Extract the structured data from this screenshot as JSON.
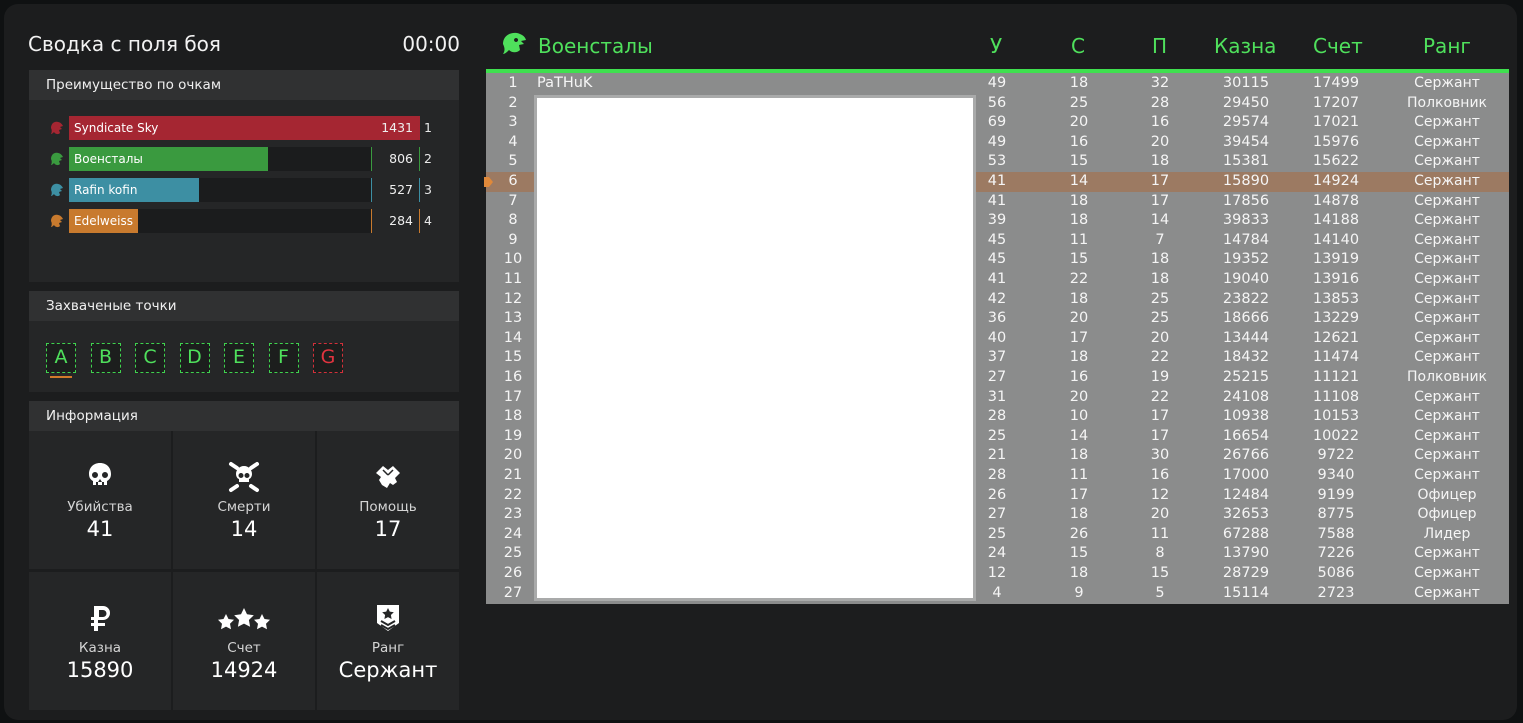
{
  "summary": {
    "title": "Сводка с поля боя",
    "timer": "00:00"
  },
  "points_advantage": {
    "title": "Преимущество по очкам",
    "teams": [
      {
        "name": "Syndicate Sky",
        "score": "1431",
        "place": "1",
        "color": "#a52632",
        "fraction": 1.0,
        "icon": "eagle-icon"
      },
      {
        "name": "Военсталы",
        "score": "806",
        "place": "2",
        "color": "#3a9a3f",
        "fraction": 0.66,
        "icon": "eagle-icon"
      },
      {
        "name": "Rafin kofin",
        "score": "527",
        "place": "3",
        "color": "#3d8fa3",
        "fraction": 0.43,
        "icon": "wolf-icon"
      },
      {
        "name": "Edelweiss",
        "score": "284",
        "place": "4",
        "color": "#c87a2e",
        "fraction": 0.23,
        "icon": "eagle-icon"
      }
    ]
  },
  "captured_points": {
    "title": "Захваченые точки",
    "points": [
      "A",
      "B",
      "C",
      "D",
      "E",
      "F",
      "G"
    ]
  },
  "info": {
    "title": "Информация",
    "kills_label": "Убийства",
    "kills": "41",
    "deaths_label": "Смерти",
    "deaths": "14",
    "assists_label": "Помощь",
    "assists": "17",
    "treasury_label": "Казна",
    "treasury": "15890",
    "score_label": "Счет",
    "score": "14924",
    "rank_label": "Ранг",
    "rank": "Сержант"
  },
  "scoreboard": {
    "team_name": "Военсталы",
    "headers": {
      "u": "У",
      "s": "С",
      "p": "П",
      "kazna": "Казна",
      "schet": "Счет",
      "rang": "Ранг"
    },
    "accent": "#4fe05c",
    "rows": [
      [
        "1",
        "PaTHuK",
        "49",
        "18",
        "32",
        "30115",
        "17499",
        "Сержант"
      ],
      [
        "2",
        "",
        "56",
        "25",
        "28",
        "29450",
        "17207",
        "Полковник"
      ],
      [
        "3",
        "",
        "69",
        "20",
        "16",
        "29574",
        "17021",
        "Сержант"
      ],
      [
        "4",
        "",
        "49",
        "16",
        "20",
        "39454",
        "15976",
        "Сержант"
      ],
      [
        "5",
        "",
        "53",
        "15",
        "18",
        "15381",
        "15622",
        "Сержант"
      ],
      [
        "6",
        "",
        "41",
        "14",
        "17",
        "15890",
        "14924",
        "Сержант"
      ],
      [
        "7",
        "",
        "41",
        "18",
        "17",
        "17856",
        "14878",
        "Сержант"
      ],
      [
        "8",
        "",
        "39",
        "18",
        "14",
        "39833",
        "14188",
        "Сержант"
      ],
      [
        "9",
        "",
        "45",
        "11",
        "7",
        "14784",
        "14140",
        "Сержант"
      ],
      [
        "10",
        "",
        "45",
        "15",
        "18",
        "19352",
        "13919",
        "Сержант"
      ],
      [
        "11",
        "",
        "41",
        "22",
        "18",
        "19040",
        "13916",
        "Сержант"
      ],
      [
        "12",
        "",
        "42",
        "18",
        "25",
        "23822",
        "13853",
        "Сержант"
      ],
      [
        "13",
        "",
        "36",
        "20",
        "25",
        "18666",
        "13229",
        "Сержант"
      ],
      [
        "14",
        "",
        "40",
        "17",
        "20",
        "13444",
        "12621",
        "Сержант"
      ],
      [
        "15",
        "",
        "37",
        "18",
        "22",
        "18432",
        "11474",
        "Сержант"
      ],
      [
        "16",
        "",
        "27",
        "16",
        "19",
        "25215",
        "11121",
        "Полковник"
      ],
      [
        "17",
        "",
        "31",
        "20",
        "22",
        "24108",
        "11108",
        "Сержант"
      ],
      [
        "18",
        "",
        "28",
        "10",
        "17",
        "10938",
        "10153",
        "Сержант"
      ],
      [
        "19",
        "",
        "25",
        "14",
        "17",
        "16654",
        "10022",
        "Сержант"
      ],
      [
        "20",
        "",
        "21",
        "18",
        "30",
        "26766",
        "9722",
        "Сержант"
      ],
      [
        "21",
        "",
        "28",
        "11",
        "16",
        "17000",
        "9340",
        "Сержант"
      ],
      [
        "22",
        "",
        "26",
        "17",
        "12",
        "12484",
        "9199",
        "Офицер"
      ],
      [
        "23",
        "",
        "27",
        "18",
        "20",
        "32653",
        "8775",
        "Офицер"
      ],
      [
        "24",
        "",
        "25",
        "26",
        "11",
        "67288",
        "7588",
        "Лидер"
      ],
      [
        "25",
        "",
        "24",
        "15",
        "8",
        "13790",
        "7226",
        "Сержант"
      ],
      [
        "26",
        "",
        "12",
        "18",
        "15",
        "28729",
        "5086",
        "Сержант"
      ],
      [
        "27",
        "",
        "4",
        "9",
        "5",
        "15114",
        "2723",
        "Сержант"
      ]
    ],
    "highlighted_row": "6"
  }
}
